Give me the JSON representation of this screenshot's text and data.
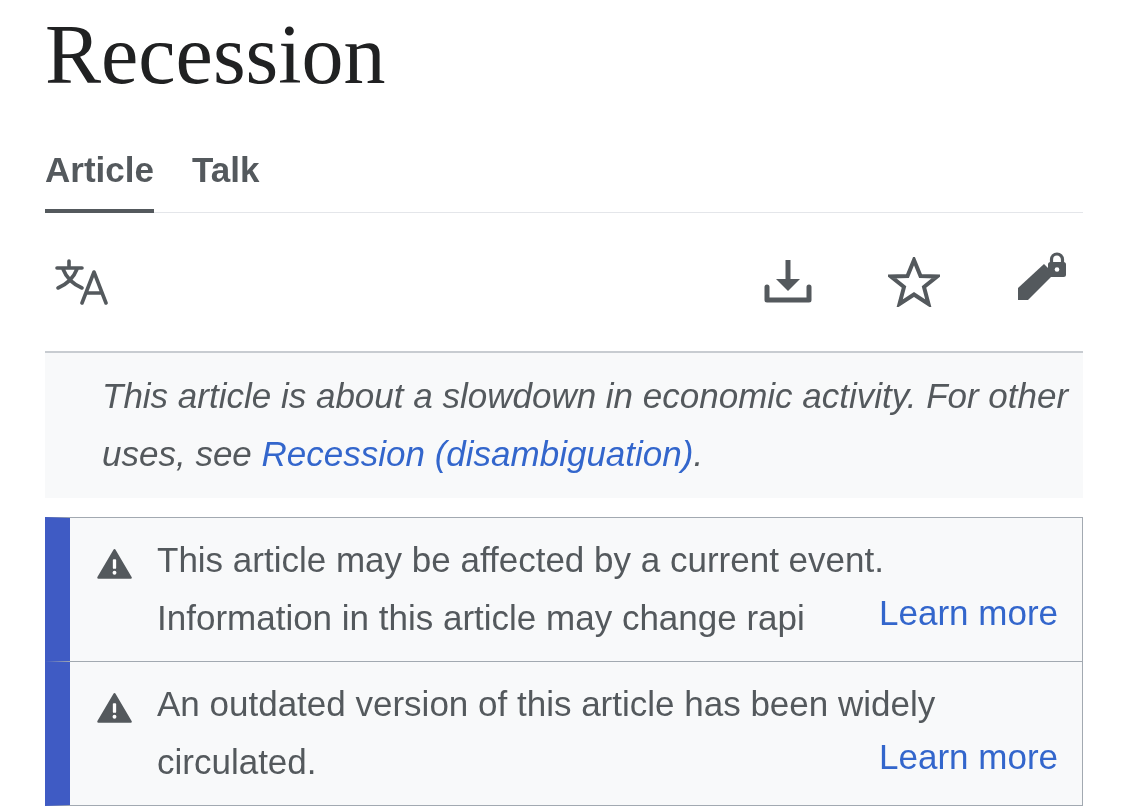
{
  "title": "Recession",
  "tabs": [
    {
      "label": "Article",
      "selected": true
    },
    {
      "label": "Talk",
      "selected": false
    }
  ],
  "hatnote": {
    "text": "This article is about a slowdown in economic activity. For other uses, see ",
    "link": "Recession (disambiguation)",
    "end": "."
  },
  "notices": [
    {
      "kind": "warning",
      "text": "This article may be affected by a current event. Information in this article may change rapi",
      "link": "Learn more"
    },
    {
      "kind": "warning",
      "text": "An outdated version of this article has been widely circulated.",
      "link": "Learn more"
    }
  ]
}
